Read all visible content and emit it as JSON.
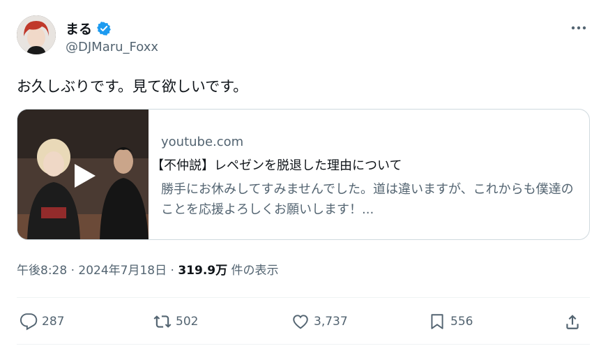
{
  "author": {
    "display_name": "まる",
    "handle": "@DJMaru_Foxx",
    "verified_color": "#1d9bf0"
  },
  "tweet": {
    "text": "お久しぶりです。見て欲しいです。"
  },
  "card": {
    "domain": "youtube.com",
    "title": "【不仲説】レペゼンを脱退した理由について",
    "description": "勝手にお休みしてすみませんでした。道は違いますが、これからも僕達のことを応援よろしくお願いします！..."
  },
  "meta": {
    "time": "午後8:28",
    "date": "2024年7月18日",
    "views": "319.9万",
    "views_label": "件の表示",
    "sep": "·"
  },
  "actions": {
    "reply_icon": "reply-icon",
    "reply_count": "287",
    "retweet_icon": "retweet-icon",
    "retweet_count": "502",
    "like_icon": "heart-icon",
    "like_count": "3,737",
    "bookmark_icon": "bookmark-icon",
    "bookmark_count": "556",
    "share_icon": "share-icon"
  }
}
